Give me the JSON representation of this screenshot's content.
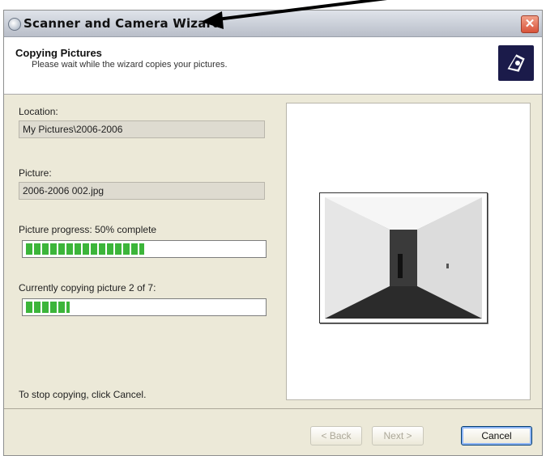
{
  "window": {
    "title": "Scanner and Camera Wizard"
  },
  "header": {
    "title": "Copying Pictures",
    "subtitle": "Please wait while the wizard copies your pictures."
  },
  "location": {
    "label": "Location:",
    "value": "My Pictures\\2006-2006"
  },
  "picture": {
    "label": "Picture:",
    "value": "2006-2006 002.jpg"
  },
  "picture_progress": {
    "label": "Picture progress: 50% complete",
    "fraction": 0.5
  },
  "copy_progress": {
    "label": "Currently copying picture 2 of 7:",
    "fraction": 0.2857
  },
  "stop_hint": "To stop copying, click Cancel.",
  "buttons": {
    "back": "< Back",
    "next": "Next >",
    "cancel": "Cancel"
  },
  "icons": {
    "title": "camera-icon",
    "close": "close-icon",
    "wizard": "scanner-camera-icon"
  },
  "colors": {
    "progress": "#3cb53a",
    "close": "#d8533a",
    "wizard_icon_bg": "#1b1b4a"
  }
}
